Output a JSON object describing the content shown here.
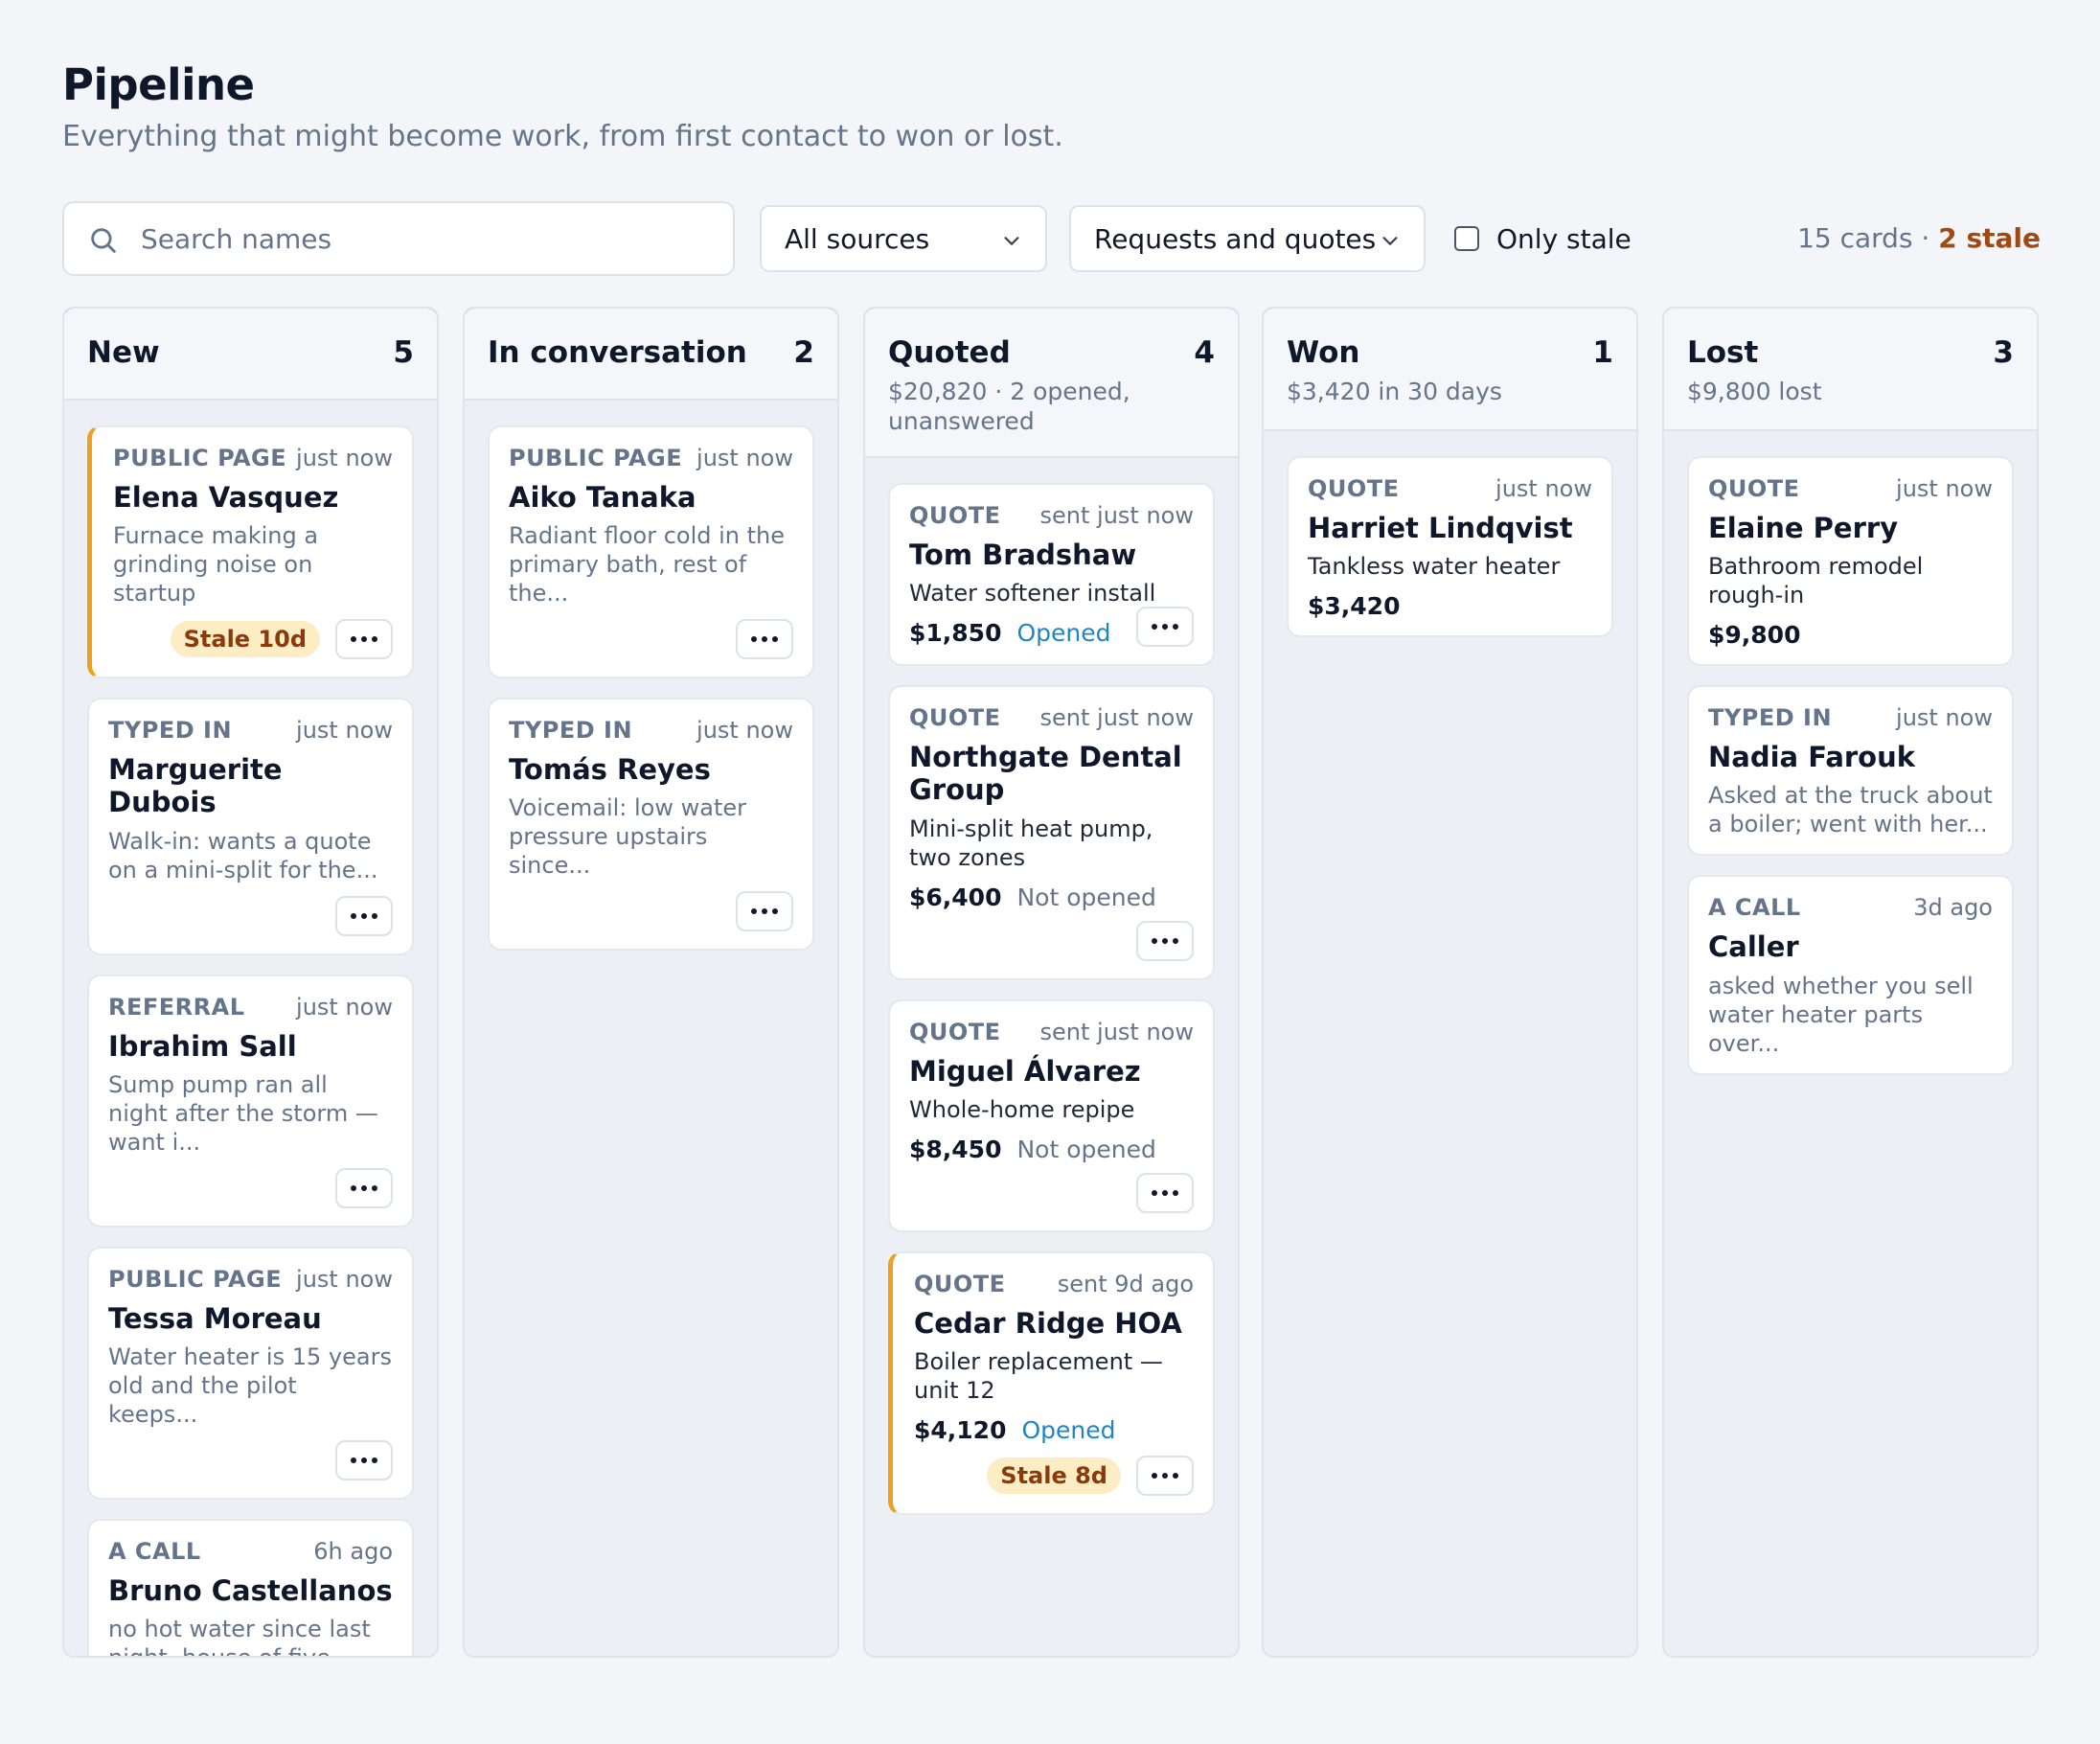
{
  "page": {
    "title": "Pipeline",
    "subtitle": "Everything that might become work, from first contact to won or lost."
  },
  "toolbar": {
    "search_placeholder": "Search names",
    "source_select": "All sources",
    "view_select": "Requests and quotes",
    "only_stale_label": "Only stale",
    "only_stale_checked": false,
    "card_count": "15 cards",
    "separator": " · ",
    "stale_count": "2 stale"
  },
  "colors": {
    "new": "#2b3a8f",
    "in_conversation": "#2b3a8f",
    "quoted": "#2aa8dd",
    "won": "#1bb37d",
    "lost": "#9aa6b8",
    "stale_accent": "#f0a01e"
  },
  "columns": [
    {
      "title": "New",
      "count": "5",
      "subtitle": "",
      "cards": [
        {
          "source": "PUBLIC PAGE",
          "time": "just now",
          "name": "Elena Vasquez",
          "desc": "Furnace making a grinding noise on startup",
          "badge": "Stale 10d"
        },
        {
          "source": "TYPED IN",
          "time": "just now",
          "name": "Marguerite Dubois",
          "desc": "Walk-in: wants a quote on a mini-split for the..."
        },
        {
          "source": "REFERRAL",
          "time": "just now",
          "name": "Ibrahim Sall",
          "desc": "Sump pump ran all night after the storm — want i..."
        },
        {
          "source": "PUBLIC PAGE",
          "time": "just now",
          "name": "Tessa Moreau",
          "desc": "Water heater is 15 years old and the pilot keeps..."
        },
        {
          "source": "A CALL",
          "time": "6h ago",
          "name": "Bruno Castellanos",
          "desc": "no hot water since last night, house of five"
        }
      ]
    },
    {
      "title": "In conversation",
      "count": "2",
      "subtitle": "",
      "cards": [
        {
          "source": "PUBLIC PAGE",
          "time": "just now",
          "name": "Aiko Tanaka",
          "desc": "Radiant floor cold in the primary bath, rest of the..."
        },
        {
          "source": "TYPED IN",
          "time": "just now",
          "name": "Tomás Reyes",
          "desc": "Voicemail: low water pressure upstairs since..."
        }
      ]
    },
    {
      "title": "Quoted",
      "count": "4",
      "subtitle": "$20,820 · 2 opened, unanswered",
      "cards": [
        {
          "source": "QUOTE",
          "time": "sent just now",
          "name": "Tom Bradshaw",
          "desc": "Water softener install",
          "amount": "$1,850",
          "status": "Opened"
        },
        {
          "source": "QUOTE",
          "time": "sent just now",
          "name": "Northgate Dental Group",
          "desc": "Mini-split heat pump, two zones",
          "amount": "$6,400",
          "status": "Not opened"
        },
        {
          "source": "QUOTE",
          "time": "sent just now",
          "name": "Miguel Álvarez",
          "desc": "Whole-home repipe",
          "amount": "$8,450",
          "status": "Not opened"
        },
        {
          "source": "QUOTE",
          "time": "sent 9d ago",
          "name": "Cedar Ridge HOA",
          "desc": "Boiler replacement — unit 12",
          "amount": "$4,120",
          "status": "Opened",
          "badge": "Stale 8d"
        }
      ]
    },
    {
      "title": "Won",
      "count": "1",
      "subtitle": "$3,420 in 30 days",
      "cards": [
        {
          "source": "QUOTE",
          "time": "just now",
          "name": "Harriet Lindqvist",
          "desc": "Tankless water heater",
          "amount": "$3,420"
        }
      ]
    },
    {
      "title": "Lost",
      "count": "3",
      "subtitle": "$9,800 lost",
      "cards": [
        {
          "source": "QUOTE",
          "time": "just now",
          "name": "Elaine Perry",
          "desc": "Bathroom remodel rough-in",
          "amount": "$9,800"
        },
        {
          "source": "TYPED IN",
          "time": "just now",
          "name": "Nadia Farouk",
          "desc": "Asked at the truck about a boiler; went with her..."
        },
        {
          "source": "A CALL",
          "time": "3d ago",
          "name": "Caller",
          "desc": "asked whether you sell water heater parts over..."
        }
      ]
    }
  ]
}
